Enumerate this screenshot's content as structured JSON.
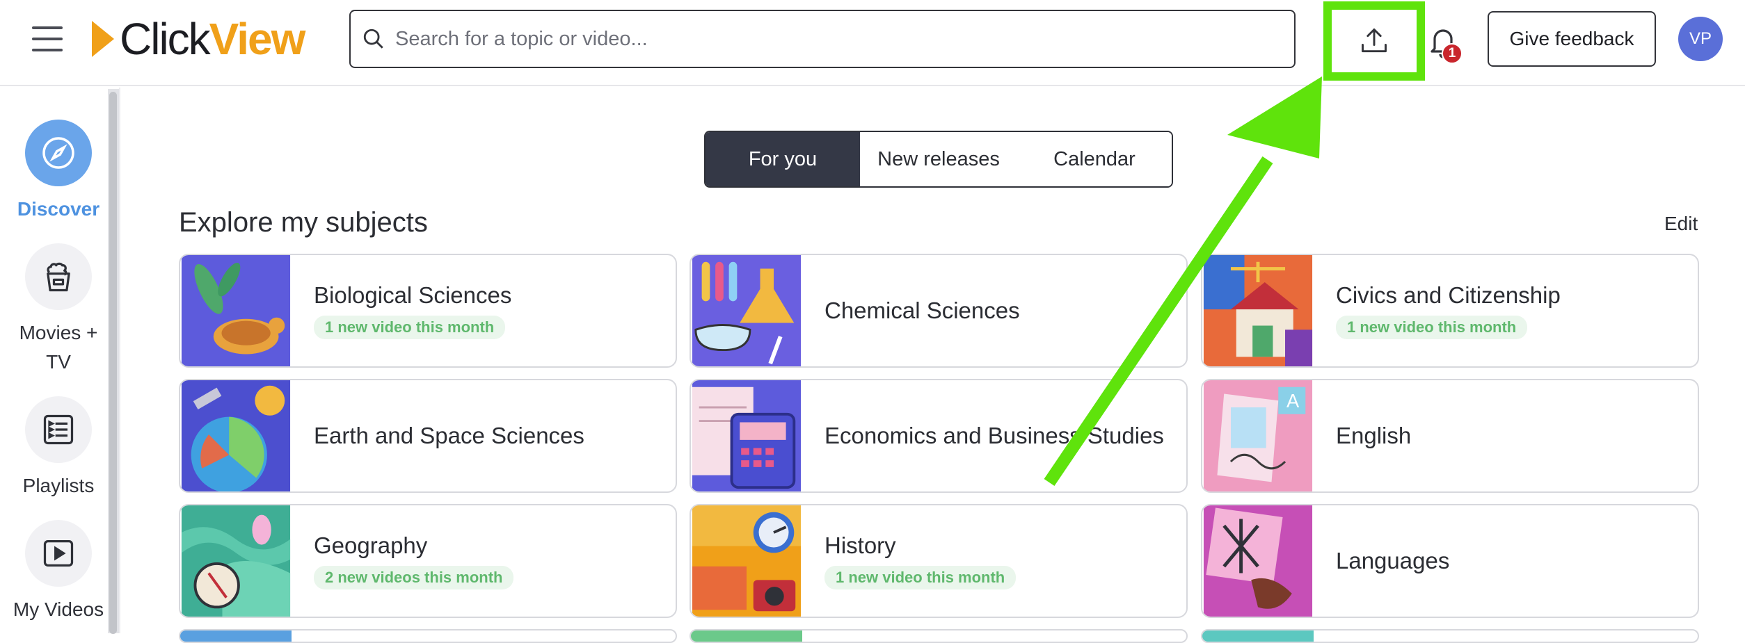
{
  "header": {
    "logo_click": "Click",
    "logo_view": "View",
    "search_placeholder": "Search for a topic or video...",
    "notification_count": "1",
    "feedback_label": "Give feedback",
    "avatar_initials": "VP"
  },
  "sidebar": {
    "items": [
      {
        "label": "Discover",
        "icon": "compass-icon"
      },
      {
        "label": "Movies + TV",
        "icon": "popcorn-icon"
      },
      {
        "label": "Playlists",
        "icon": "playlist-icon"
      },
      {
        "label": "My Videos",
        "icon": "play-video-icon"
      }
    ]
  },
  "tabs": [
    {
      "label": "For you"
    },
    {
      "label": "New releases"
    },
    {
      "label": "Calendar"
    }
  ],
  "section": {
    "title": "Explore my subjects",
    "edit_label": "Edit"
  },
  "subjects": [
    {
      "title": "Biological Sciences",
      "badge": "1 new video this month"
    },
    {
      "title": "Chemical Sciences",
      "badge": ""
    },
    {
      "title": "Civics and Citizenship",
      "badge": "1 new video this month"
    },
    {
      "title": "Earth and Space Sciences",
      "badge": ""
    },
    {
      "title": "Economics and Business Studies",
      "badge": ""
    },
    {
      "title": "English",
      "badge": ""
    },
    {
      "title": "Geography",
      "badge": "2 new videos this month"
    },
    {
      "title": "History",
      "badge": "1 new video this month"
    },
    {
      "title": "Languages",
      "badge": ""
    }
  ],
  "colors": {
    "accent_orange": "#f0a019",
    "highlight_green": "#5fe30c",
    "active_tab": "#343846",
    "discover_blue": "#6aa5ea",
    "badge_green": "#5fb86d"
  }
}
